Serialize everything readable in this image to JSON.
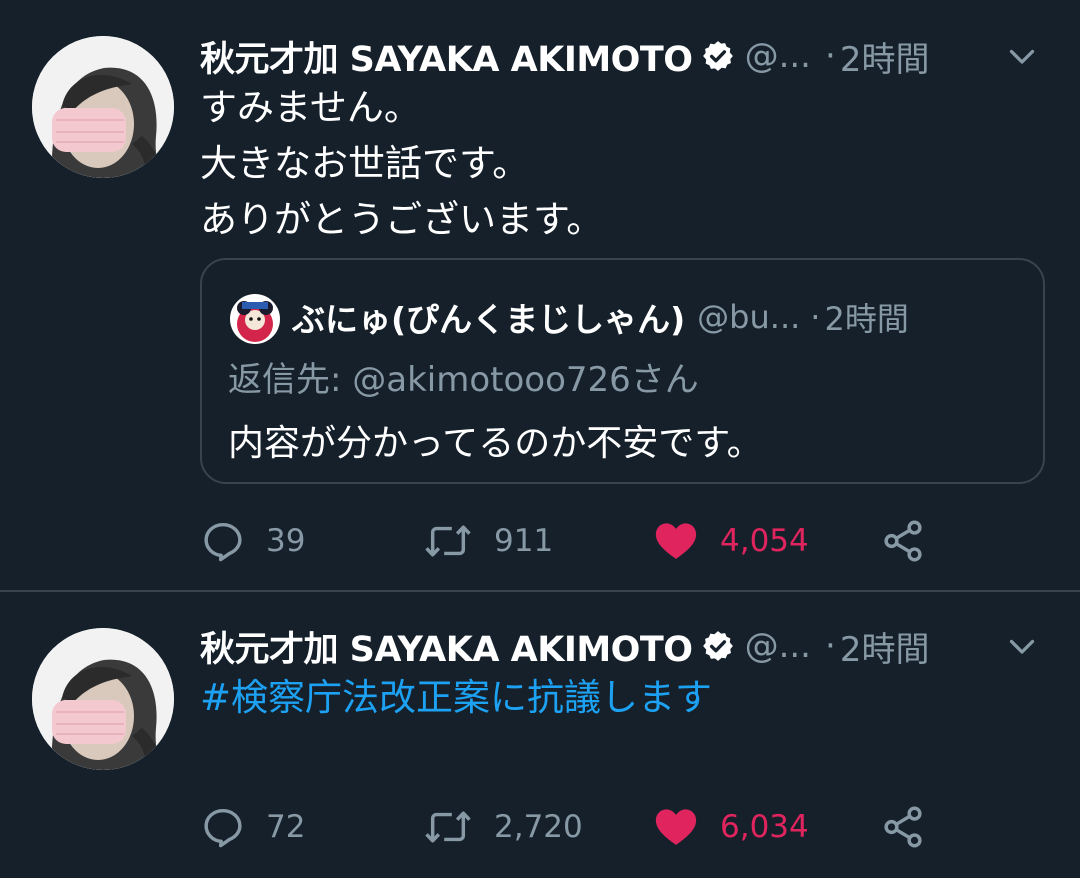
{
  "colors": {
    "background": "#15202b",
    "divider": "#38444d",
    "secondary_text": "#8899a6",
    "hashtag": "#1da1f2",
    "like": "#e0245e",
    "verified_badge": "#ffffff"
  },
  "tweets": [
    {
      "author": {
        "name": "秋元才加 SAYAKA AKIMOTO",
        "handle": "@...",
        "verified": true
      },
      "separator": "·",
      "time": "2時間",
      "text_lines": [
        "すみません。",
        "大きなお世話です。",
        "ありがとうございます。"
      ],
      "quoted": {
        "author_name": "ぶにゅ(ぴんくまじしゃん)",
        "handle": "@bu...",
        "separator": "·",
        "time": "2時間",
        "reply_to": "返信先: @akimotooo726さん",
        "text": "内容が分かってるのか不安です。"
      },
      "actions": {
        "replies": "39",
        "retweets": "911",
        "likes": "4,054",
        "liked": true
      },
      "icons": [
        "reply-icon",
        "retweet-icon",
        "heart-icon",
        "share-icon",
        "chevron-down-icon",
        "verified-icon"
      ]
    },
    {
      "author": {
        "name": "秋元才加 SAYAKA AKIMOTO",
        "handle": "@...",
        "verified": true
      },
      "separator": "·",
      "time": "2時間",
      "text": "#検察庁法改正案に抗議します",
      "actions": {
        "replies": "72",
        "retweets": "2,720",
        "likes": "6,034",
        "liked": true
      }
    }
  ]
}
